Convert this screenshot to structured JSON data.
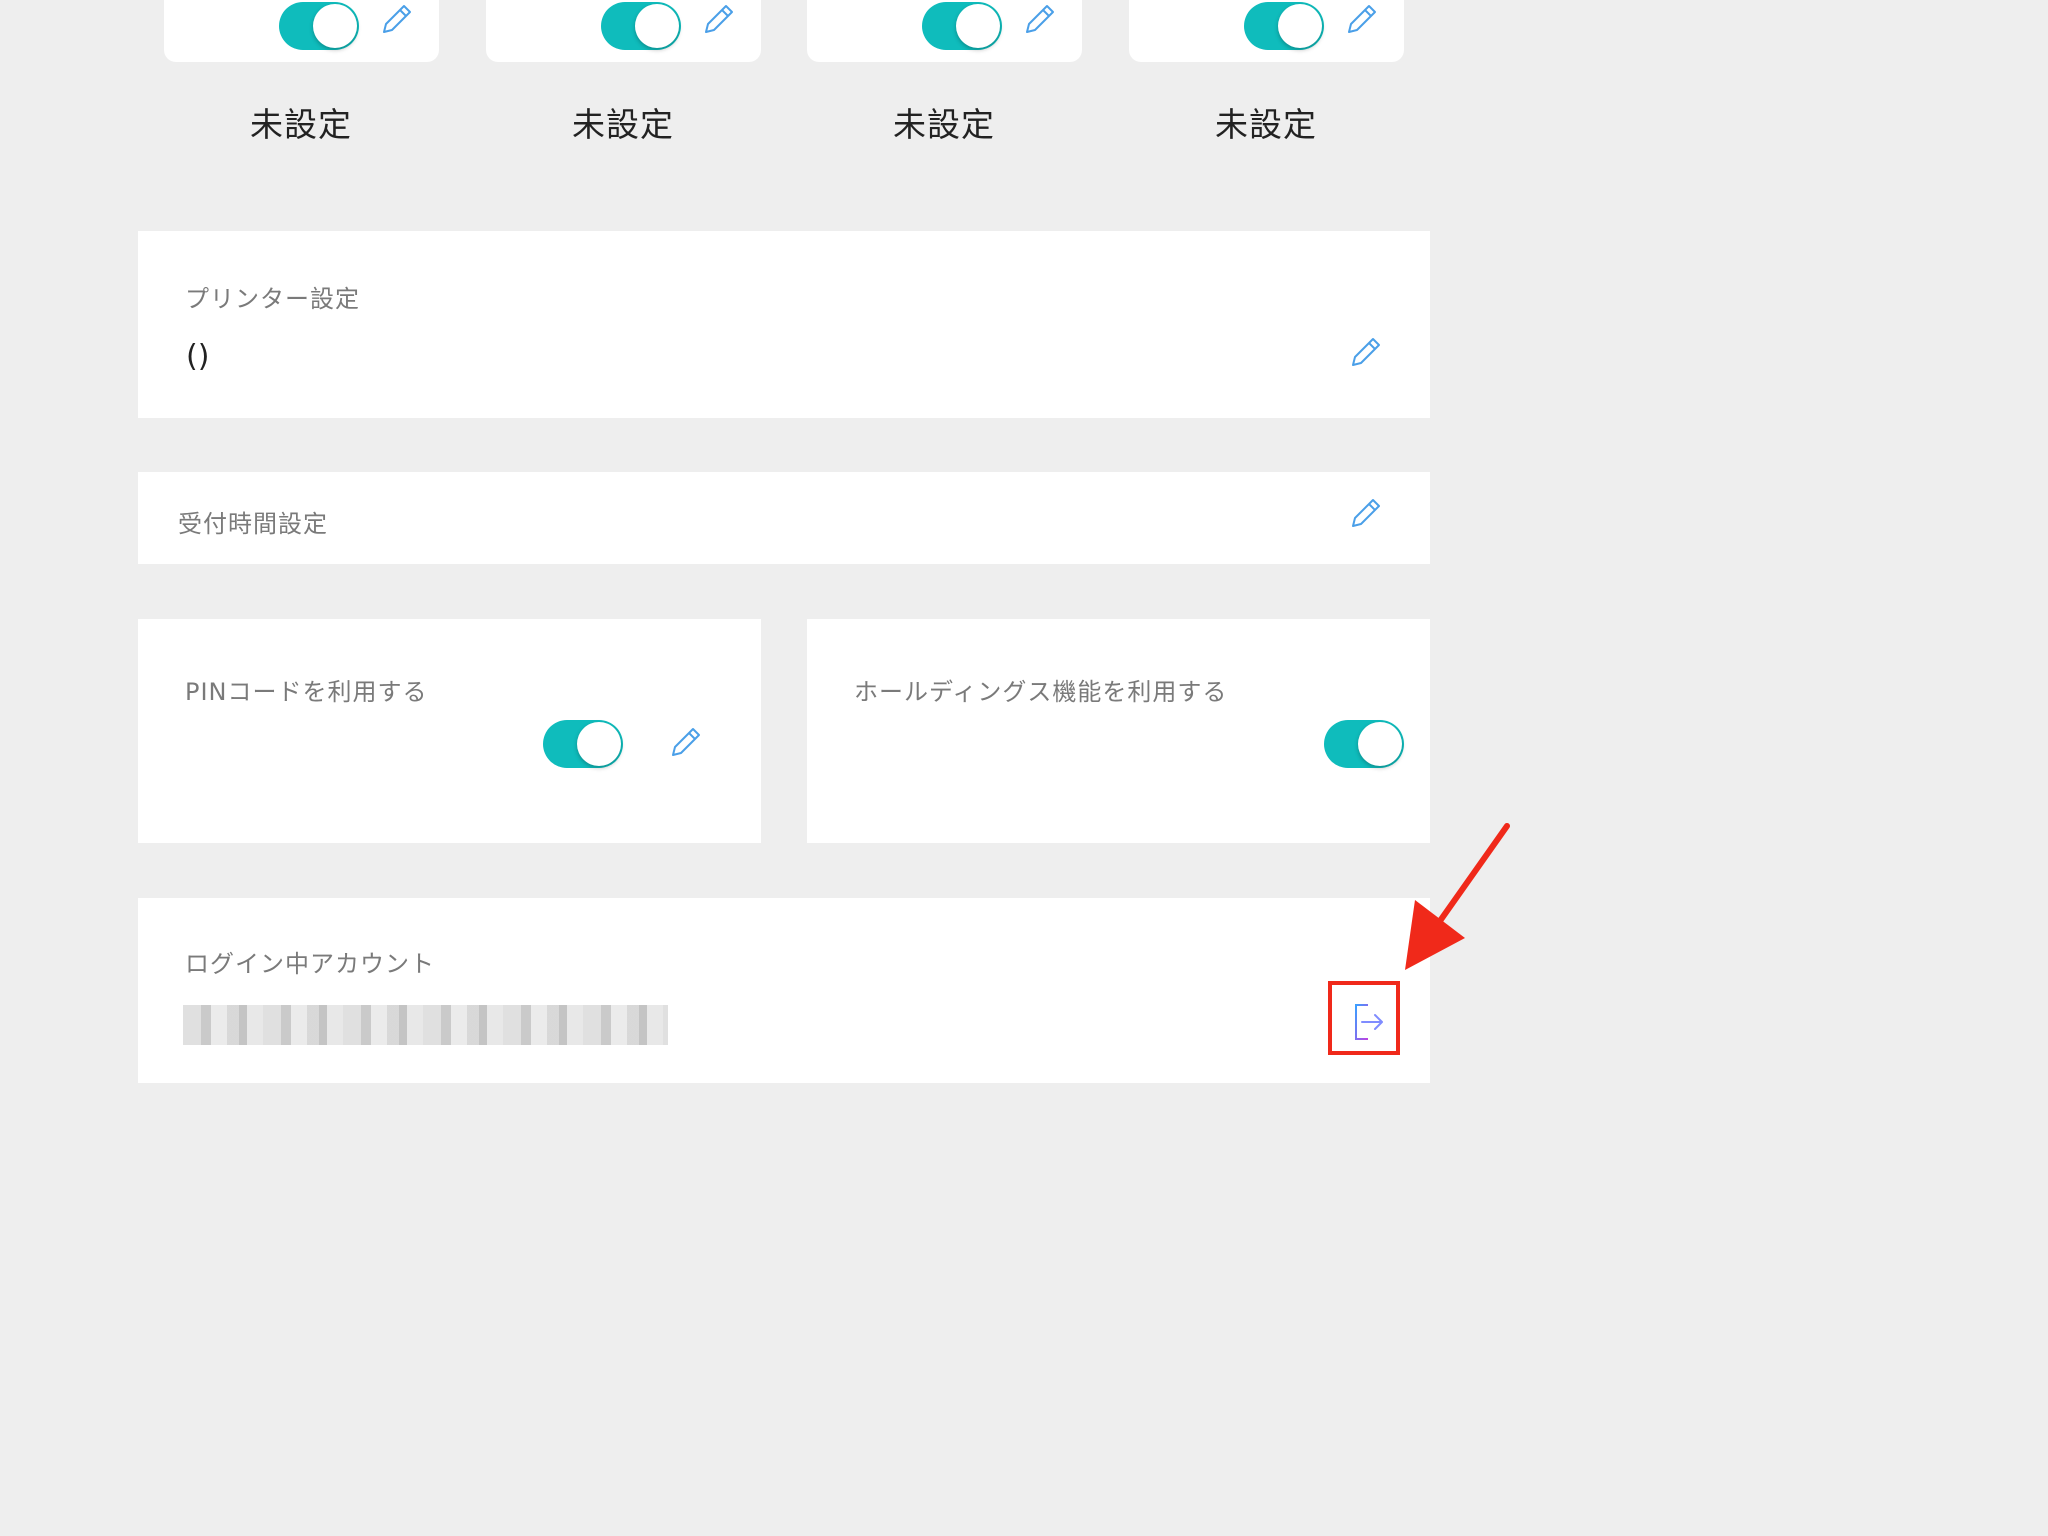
{
  "services": [
    {
      "status": "未設定",
      "enabled": true,
      "icon_toggle": "toggle-switch",
      "icon_edit": "pencil-icon"
    },
    {
      "status": "未設定",
      "enabled": true,
      "icon_toggle": "toggle-switch",
      "icon_edit": "pencil-icon"
    },
    {
      "status": "未設定",
      "enabled": true,
      "icon_toggle": "toggle-switch",
      "icon_edit": "pencil-icon"
    },
    {
      "status": "未設定",
      "enabled": true,
      "icon_toggle": "toggle-switch",
      "icon_edit": "pencil-icon"
    }
  ],
  "printer": {
    "title": "プリンター設定",
    "value": "()"
  },
  "reception_hours": {
    "title": "受付時間設定"
  },
  "pin": {
    "title": "PINコードを利用する",
    "enabled": true
  },
  "holdings": {
    "title": "ホールディングス機能を利用する",
    "enabled": true
  },
  "account": {
    "title": "ログイン中アカウント",
    "logout_icon": "logout-icon"
  },
  "colors": {
    "background": "#eeeeee",
    "toggle_on": "#0fbcbc",
    "edit_icon": "#4a9fe8",
    "annotation_red": "#f0291a"
  }
}
